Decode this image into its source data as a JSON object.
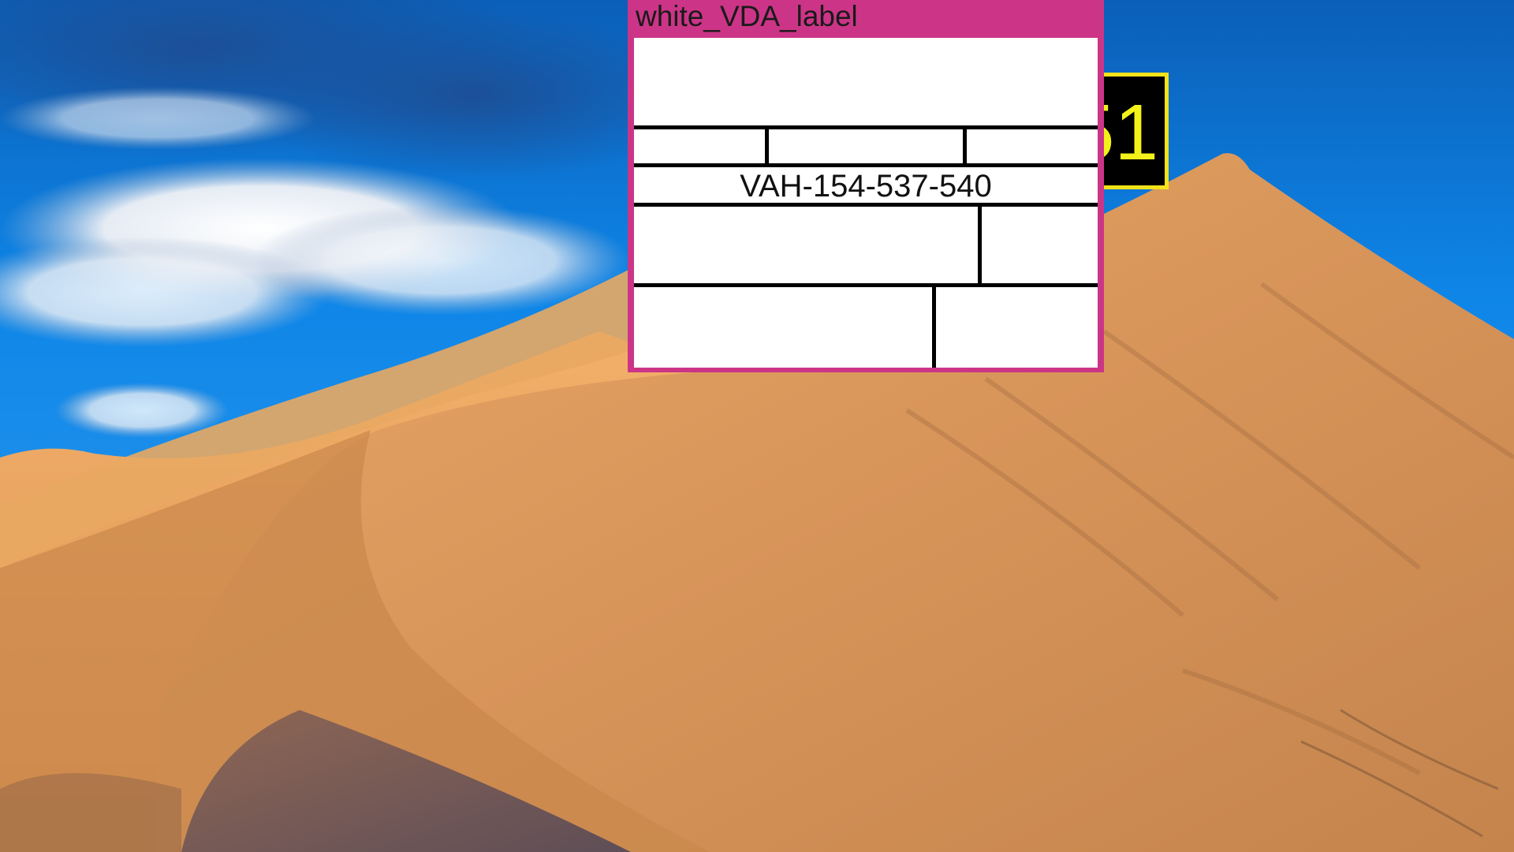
{
  "window": {
    "title": "white_VDA_label",
    "accent_color": "#cc3587"
  },
  "label": {
    "code": "VAH-154-537-540",
    "background": "#ffffff"
  },
  "badge": {
    "number": "51",
    "border_color": "#f2e21a",
    "text_color": "#f2f21a"
  },
  "wallpaper": {
    "subject": "sand dune under blue sky with clouds"
  }
}
